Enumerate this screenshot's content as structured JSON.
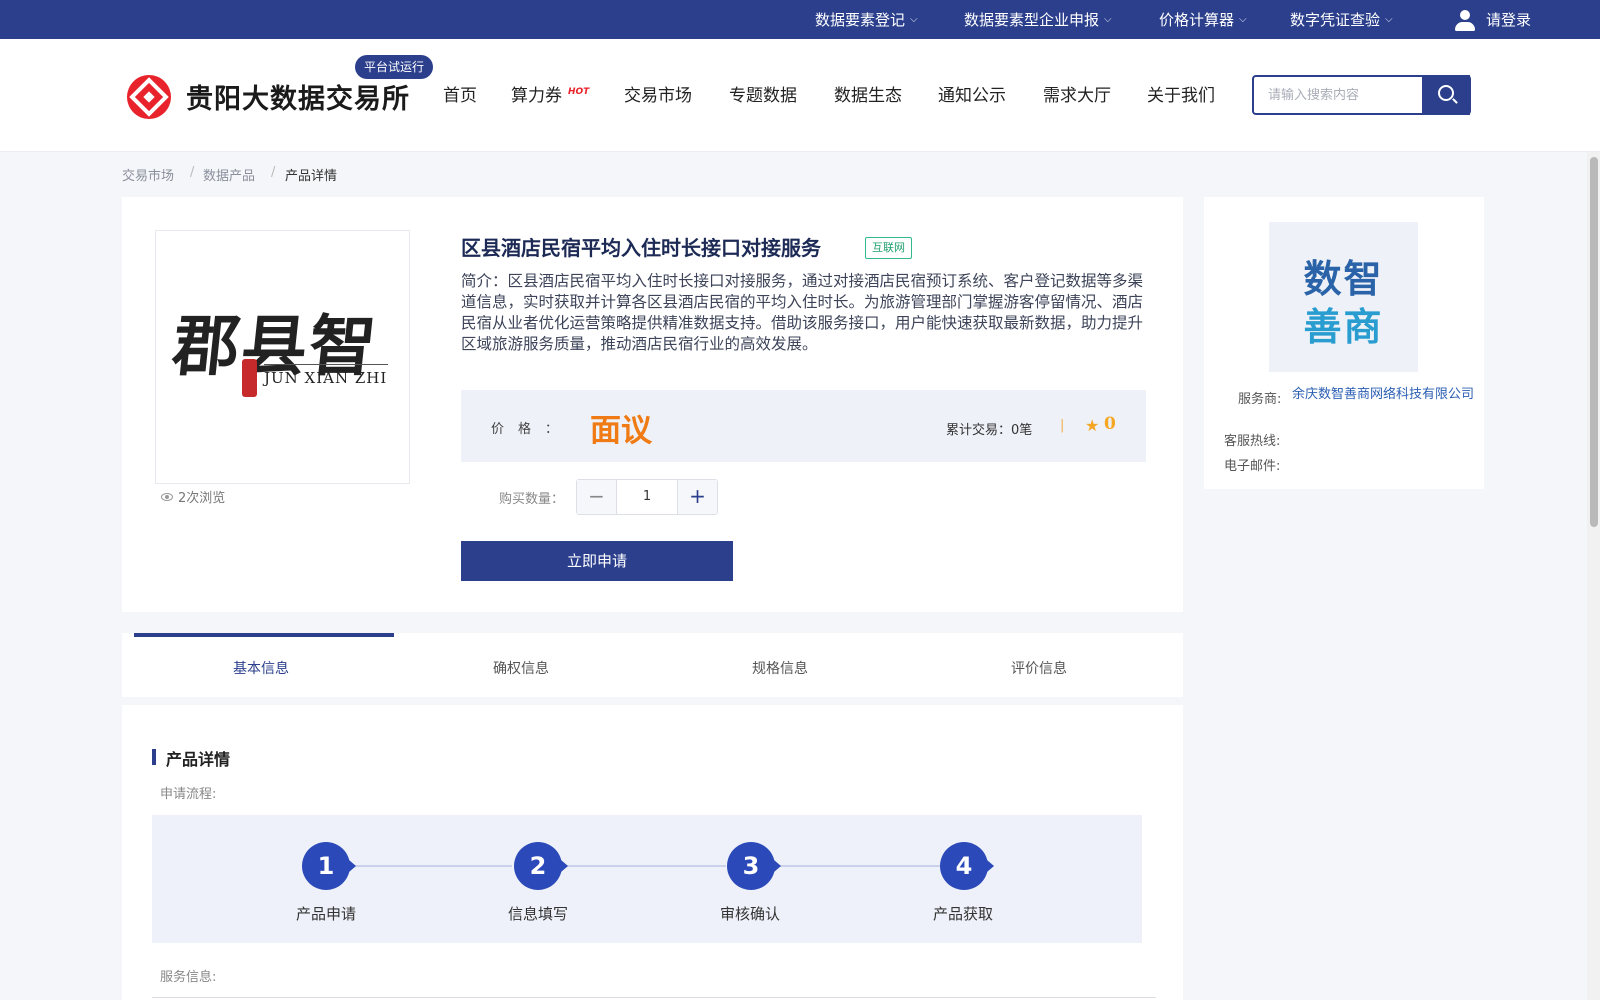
{
  "topbar": {
    "items": [
      {
        "label": "数据要素登记"
      },
      {
        "label": "数据要素型企业申报"
      },
      {
        "label": "价格计算器"
      },
      {
        "label": "数字凭证查验"
      }
    ],
    "login_label": "请登录"
  },
  "header": {
    "site_name": "贵阳大数据交易所",
    "badge": "平台试运行",
    "nav": [
      "首页",
      "算力券",
      "交易市场",
      "专题数据",
      "数据生态",
      "通知公示",
      "需求大厅",
      "关于我们"
    ],
    "hot_badge": "HOT",
    "search_placeholder": "请输入搜索内容"
  },
  "breadcrumb": [
    "交易市场",
    "数据产品",
    "产品详情"
  ],
  "product": {
    "image_brand": "郡县智",
    "image_latin": "JUN XIAN ZHI",
    "views": "2次浏览",
    "title": "区县酒店民宿平均入住时长接口对接服务",
    "tag": "互联网",
    "intro": "简介：区县酒店民宿平均入住时长接口对接服务，通过对接酒店民宿预订系统、客户登记数据等多渠道信息，实时获取并计算各区县酒店民宿的平均入住时长。为旅游管理部门掌握游客停留情况、酒店民宿从业者优化运营策略提供精准数据支持。借助该服务接口，用户能快速获取最新数据，助力提升区域旅游服务质量，推动酒店民宿行业的高效发展。",
    "price_label": "价格：",
    "price_value": "面议",
    "tx_label": "累计交易：0笔",
    "tx_sep": "|",
    "rating": "0",
    "qty_label": "购买数量：",
    "qty_value": "1",
    "apply_label": "立即申请"
  },
  "provider": {
    "logo_line1": "数智",
    "logo_line2": "善商",
    "service_label": "服务商:",
    "service_value": "余庆数智善商网络科技有限公司",
    "hotline_label": "客服热线:",
    "email_label": "电子邮件:"
  },
  "tabs": [
    {
      "label": "基本信息"
    },
    {
      "label": "确权信息"
    },
    {
      "label": "规格信息"
    },
    {
      "label": "评价信息"
    }
  ],
  "details": {
    "section_title": "产品详情",
    "flow_label": "申请流程:",
    "steps": [
      {
        "num": "1",
        "label": "产品申请"
      },
      {
        "num": "2",
        "label": "信息填写"
      },
      {
        "num": "3",
        "label": "审核确认"
      },
      {
        "num": "4",
        "label": "产品获取"
      }
    ],
    "service_label": "服务信息:"
  },
  "colors": {
    "brand": "#2b3f8c",
    "price": "#f07a13",
    "logo_red": "#e8232b",
    "tag_green": "#21a06f"
  }
}
